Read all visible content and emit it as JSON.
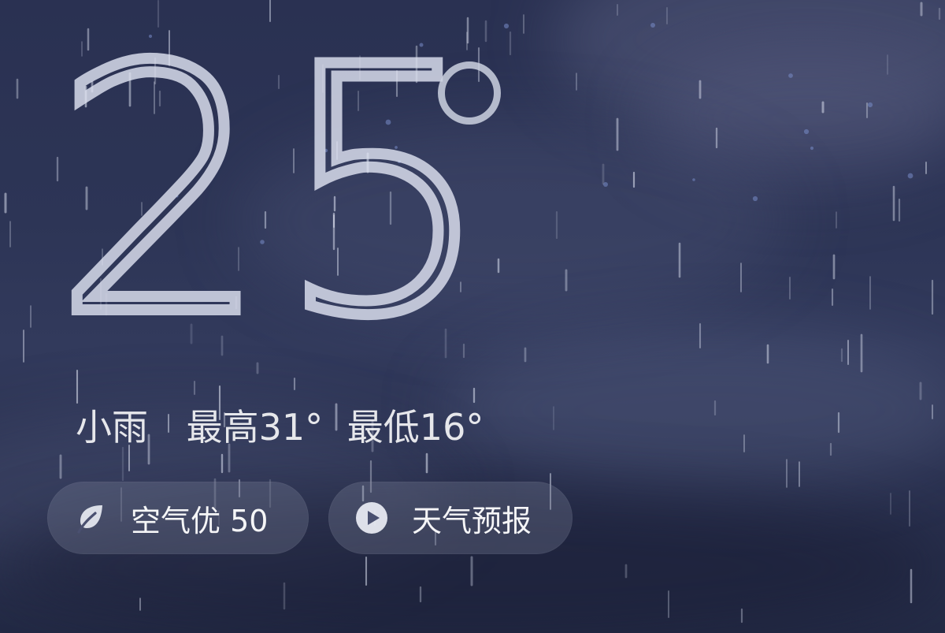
{
  "weather": {
    "temperature": "25",
    "unit_symbol": "°",
    "condition": "小雨",
    "high": "最高31°",
    "low": "最低16°"
  },
  "buttons": {
    "air_quality": {
      "label": "空气优 50",
      "icon": "leaf-icon"
    },
    "forecast": {
      "label": "天气预报",
      "icon": "play-icon"
    }
  },
  "colors": {
    "background": "#2d3556",
    "text": "#ffffff",
    "pill_background": "#6a6f8c"
  }
}
